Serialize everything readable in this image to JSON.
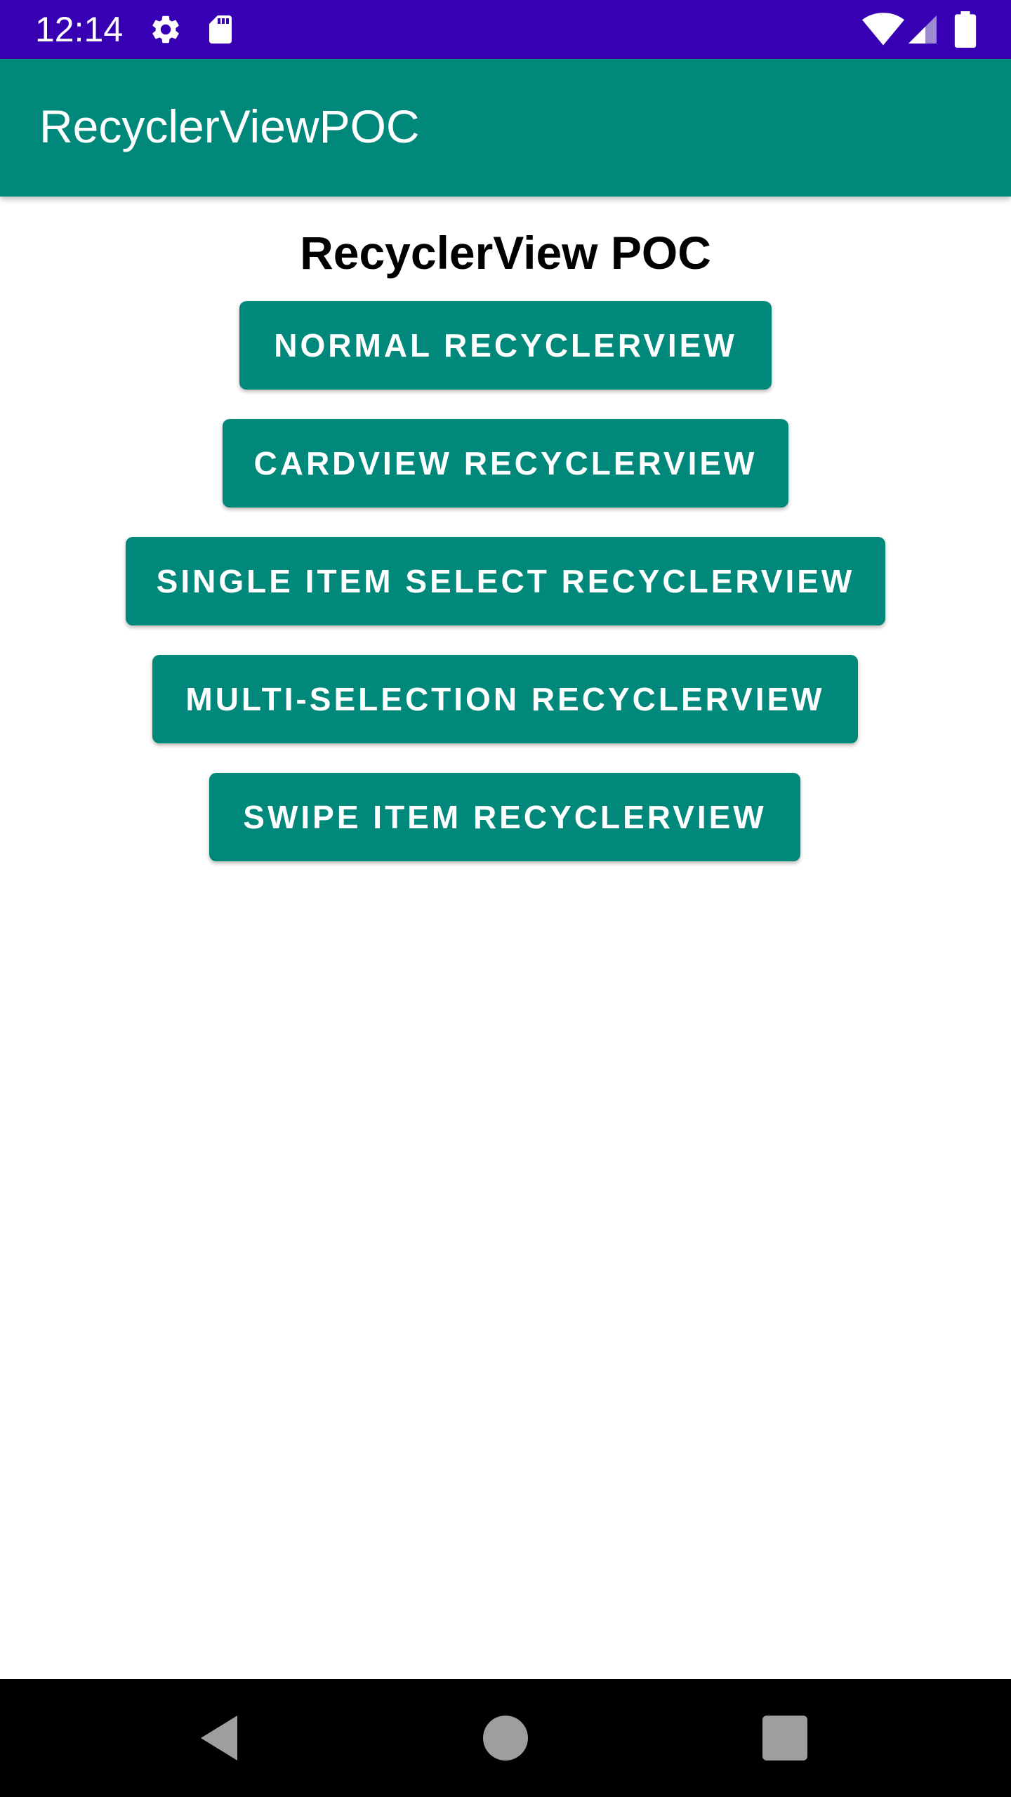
{
  "status_bar": {
    "time": "12:14",
    "icons": [
      "gear-icon",
      "sd-card-icon",
      "wifi-icon",
      "cell-signal-icon",
      "battery-icon"
    ],
    "background_color": "#3700b3"
  },
  "app_bar": {
    "title": "RecyclerViewPOC",
    "background_color": "#00897b"
  },
  "main": {
    "heading": "RecyclerView POC",
    "buttons": [
      {
        "label": "NORMAL RECYCLERVIEW"
      },
      {
        "label": "CARDVIEW RECYCLERVIEW"
      },
      {
        "label": "SINGLE ITEM SELECT RECYCLERVIEW"
      },
      {
        "label": "MULTI-SELECTION RECYCLERVIEW"
      },
      {
        "label": "SWIPE ITEM RECYCLERVIEW"
      }
    ],
    "button_color": "#00897b"
  },
  "nav_bar": {
    "icons": [
      "back-icon",
      "home-icon",
      "recents-icon"
    ]
  }
}
